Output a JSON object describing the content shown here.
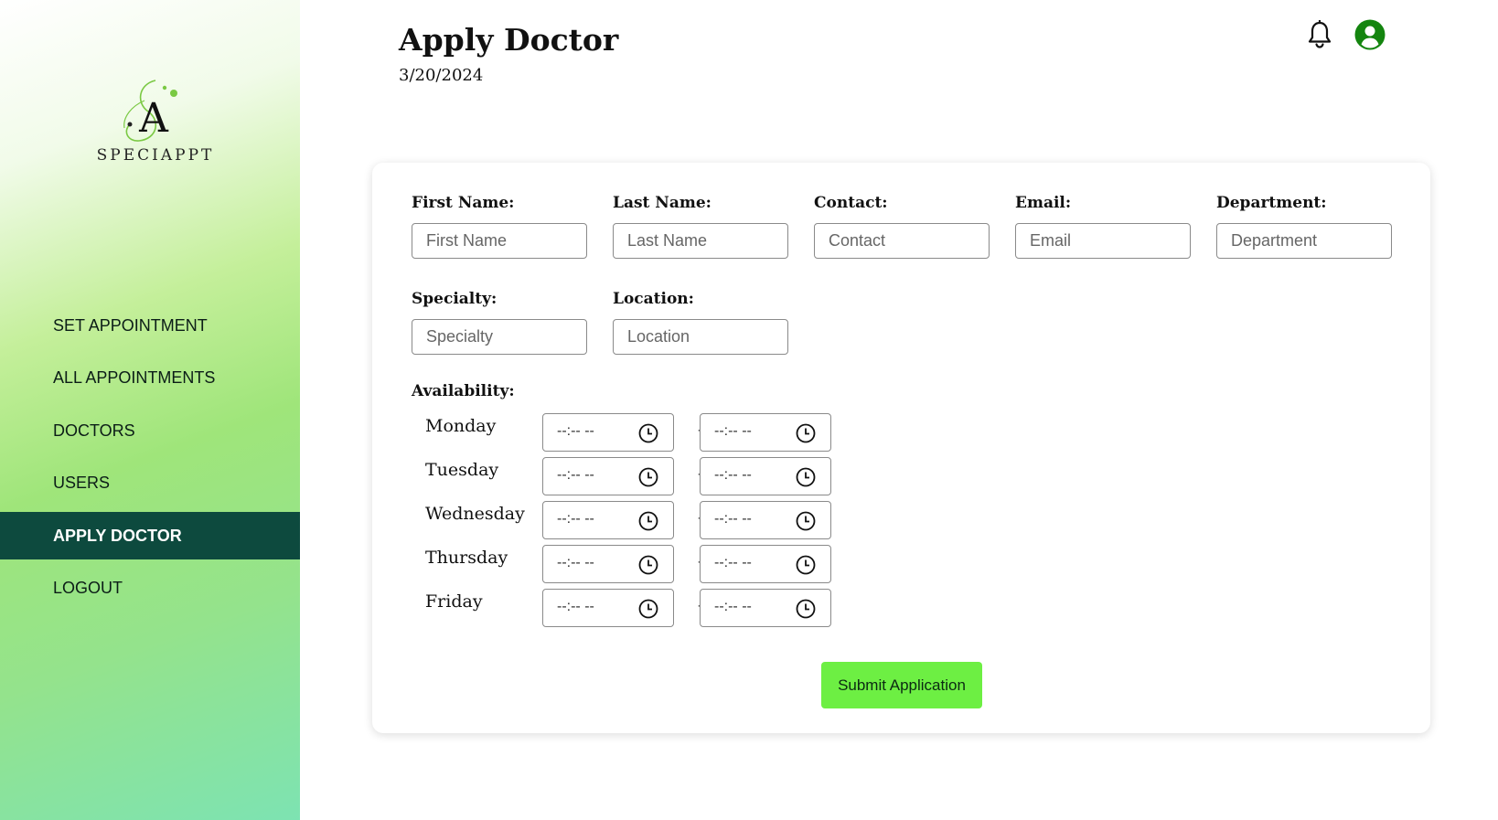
{
  "brand": {
    "name": "SPECIAPPT"
  },
  "sidebar": {
    "items": [
      {
        "label": "SET APPOINTMENT",
        "active": false
      },
      {
        "label": "ALL APPOINTMENTS",
        "active": false
      },
      {
        "label": "DOCTORS",
        "active": false
      },
      {
        "label": "USERS",
        "active": false
      },
      {
        "label": "APPLY DOCTOR",
        "active": true
      },
      {
        "label": "LOGOUT",
        "active": false
      }
    ]
  },
  "header": {
    "title": "Apply Doctor",
    "date": "3/20/2024",
    "icons": [
      "bell-icon",
      "account-icon"
    ]
  },
  "form": {
    "fields": [
      {
        "label": "First Name:",
        "placeholder": "First Name",
        "value": ""
      },
      {
        "label": "Last Name:",
        "placeholder": "Last Name",
        "value": ""
      },
      {
        "label": "Contact:",
        "placeholder": "Contact",
        "value": ""
      },
      {
        "label": "Email:",
        "placeholder": "Email",
        "value": ""
      },
      {
        "label": "Department:",
        "placeholder": "Department",
        "value": ""
      },
      {
        "label": "Specialty:",
        "placeholder": "Specialty",
        "value": ""
      },
      {
        "label": "Location:",
        "placeholder": "Location",
        "value": ""
      }
    ],
    "availability": {
      "label": "Availability:",
      "separator": "-",
      "days": [
        {
          "day": "Monday",
          "start": "--:-- --",
          "end": "--:-- --"
        },
        {
          "day": "Tuesday",
          "start": "--:-- --",
          "end": "--:-- --"
        },
        {
          "day": "Wednesday",
          "start": "--:-- --",
          "end": "--:-- --"
        },
        {
          "day": "Thursday",
          "start": "--:-- --",
          "end": "--:-- --"
        },
        {
          "day": "Friday",
          "start": "--:-- --",
          "end": "--:-- --"
        }
      ]
    },
    "submit_label": "Submit Application"
  },
  "colors": {
    "active_nav": "#0d4a3e",
    "submit_button": "#6def43",
    "account_icon": "#14850f"
  }
}
